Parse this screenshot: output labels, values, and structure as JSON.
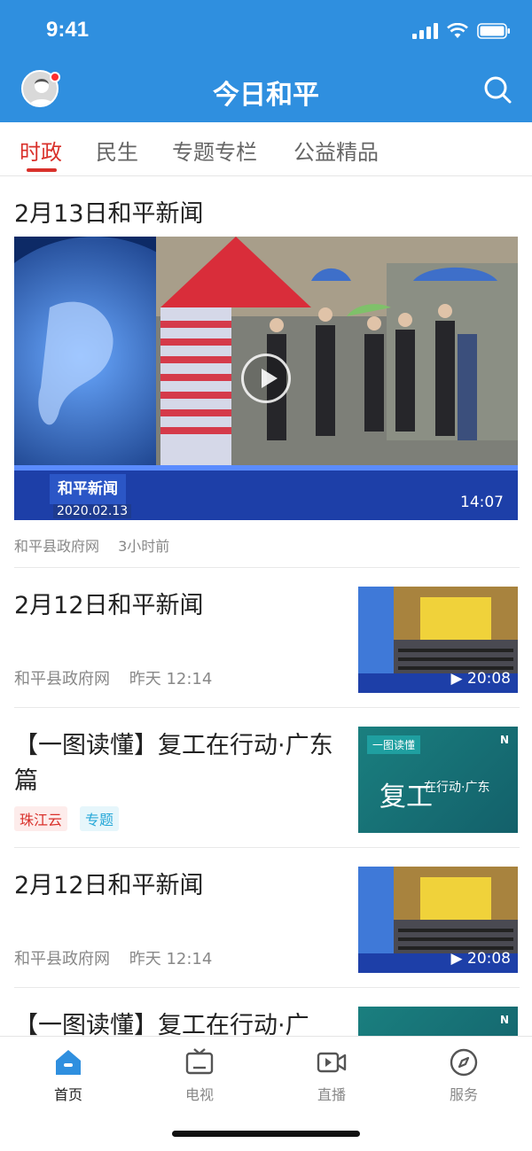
{
  "status_bar": {
    "time": "9:41"
  },
  "header": {
    "title": "今日和平"
  },
  "tabs": [
    {
      "label": "时政",
      "active": true
    },
    {
      "label": "民生",
      "active": false
    },
    {
      "label": "专题专栏",
      "active": false
    },
    {
      "label": "公益精品",
      "active": false
    }
  ],
  "feed": {
    "headline": {
      "title": "2月13日和平新闻",
      "duration": "14:07",
      "caption": "和平新闻",
      "caption_date": "2020.02.13",
      "source": "和平县政府网",
      "time": "3小时前"
    },
    "items": [
      {
        "title": "2月12日和平新闻",
        "source": "和平县政府网",
        "time": "昨天 12:14",
        "duration": "▶ 20:08",
        "thumb": "video"
      },
      {
        "title": "【一图读懂】复工在行动·广东篇",
        "tags": [
          "珠江云",
          "专题"
        ],
        "thumb": "graphic",
        "thumb_label": "一图读懂",
        "thumb_logo": "N",
        "thumb_main": "复工",
        "thumb_sub": "在行动·广东"
      },
      {
        "title": "2月12日和平新闻",
        "source": "和平县政府网",
        "time": "昨天 12:14",
        "duration": "▶ 20:08",
        "thumb": "video"
      },
      {
        "title": "【一图读懂】复工在行动·广",
        "thumb": "graphic",
        "thumb_logo": "N"
      }
    ]
  },
  "tabbar": [
    {
      "label": "首页",
      "icon": "home-icon",
      "active": true
    },
    {
      "label": "电视",
      "icon": "tv-icon",
      "active": false
    },
    {
      "label": "直播",
      "icon": "live-video-icon",
      "active": false
    },
    {
      "label": "服务",
      "icon": "compass-icon",
      "active": false
    }
  ],
  "colors": {
    "primary": "#2f8fdf",
    "accent_red": "#d9312b",
    "tag_blue": "#26a8d8"
  }
}
